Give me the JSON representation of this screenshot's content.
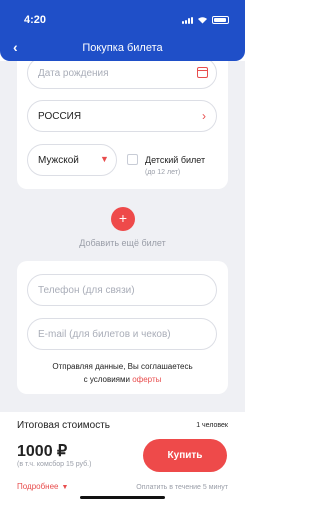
{
  "status_bar": {
    "time": "4:20"
  },
  "header": {
    "back_icon": "‹",
    "title": "Покупка билета"
  },
  "passenger": {
    "birth_date_placeholder": "Дата рождения",
    "citizenship": "РОССИЯ",
    "gender": "Мужской",
    "child_ticket_label": "Детский билет",
    "child_ticket_note": "(до 12 лет)",
    "child_ticket_checked": false
  },
  "add_ticket": {
    "icon": "+",
    "label": "Добавить ещё билет"
  },
  "contacts": {
    "phone_placeholder": "Телефон (для связи)",
    "email_placeholder": "E-mail (для билетов и чеков)",
    "consent_line1": "Отправляя данные, Вы соглашаетесь",
    "consent_line2_prefix": "с условиями ",
    "offer_link": "оферты"
  },
  "footer": {
    "total_label": "Итоговая стоимость",
    "passenger_count": "1 человек",
    "price": "1000 ₽",
    "fee_note": "(в т.ч. комсбор 15 руб.)",
    "buy_label": "Купить",
    "details_label": "Подробнее",
    "payment_note": "Оплатить в течение 5 минут"
  },
  "colors": {
    "header": "#1f4fc8",
    "accent": "#ee4a4a",
    "background": "#eff0f4"
  }
}
